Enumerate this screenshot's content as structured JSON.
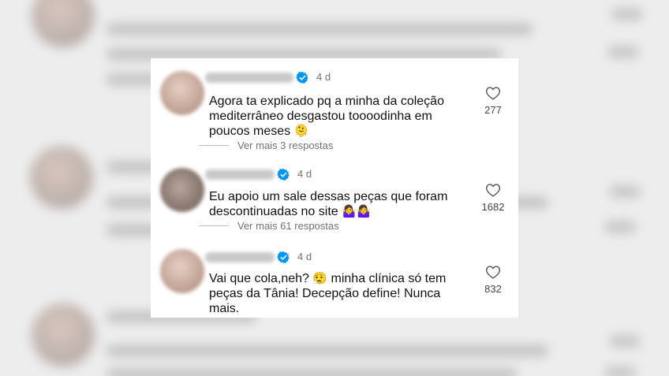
{
  "comments": [
    {
      "time": "4 d",
      "text_line1": "Agora ta explicado pq a minha da coleção",
      "text_line2": "mediterrâneo desgastou toooodinha em",
      "text_line3": "poucos meses",
      "emoji": "🫠",
      "replies": "Ver mais 3 respostas",
      "likes": "277"
    },
    {
      "time": "4 d",
      "text_line1": "Eu apoio um sale dessas peças que foram",
      "text_line2": "descontinuadas no site",
      "emoji": "🤷‍♀️🤷‍♀️",
      "replies": "Ver mais 61 respostas",
      "likes": "1682"
    },
    {
      "time": "4 d",
      "text_line1a": "Vai que cola,neh?",
      "emoji": "😮‍💨",
      "text_line1b": "minha clínica só tem",
      "text_line2": "peças da Tânia! Decepção define! Nunca",
      "text_line3": "mais.",
      "likes": "832"
    }
  ],
  "colors": {
    "verified": "#0095f6",
    "meta": "#737373",
    "text": "#111111"
  },
  "icons": {
    "verified": "verified-badge-icon",
    "like": "heart-outline-icon"
  }
}
